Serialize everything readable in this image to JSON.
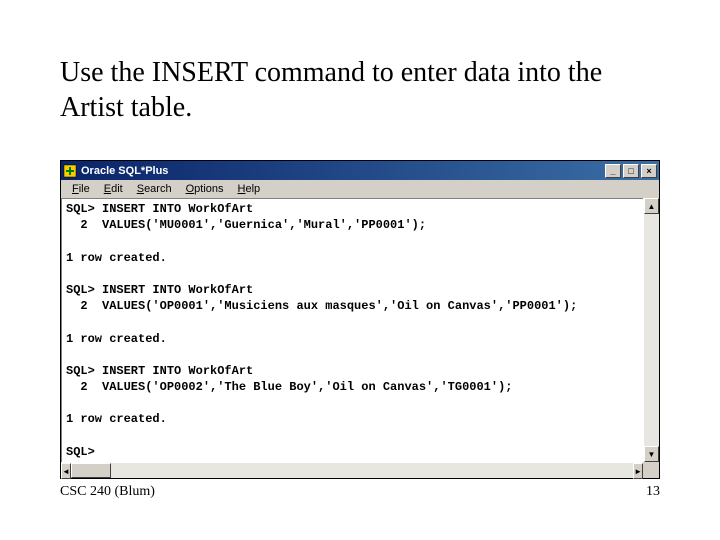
{
  "slide": {
    "title": "Use the INSERT command to enter data into the Artist table."
  },
  "window": {
    "title": "Oracle SQL*Plus"
  },
  "menu": {
    "file": "File",
    "edit": "Edit",
    "search": "Search",
    "options": "Options",
    "help": "Help"
  },
  "terminal": {
    "content": "SQL> INSERT INTO WorkOfArt\n  2  VALUES('MU0001','Guernica','Mural','PP0001');\n\n1 row created.\n\nSQL> INSERT INTO WorkOfArt\n  2  VALUES('OP0001','Musiciens aux masques','Oil on Canvas','PP0001');\n\n1 row created.\n\nSQL> INSERT INTO WorkOfArt\n  2  VALUES('OP0002','The Blue Boy','Oil on Canvas','TG0001');\n\n1 row created.\n\nSQL>"
  },
  "footer": {
    "course": "CSC 240 (Blum)",
    "page": "13"
  },
  "icons": {
    "min": "_",
    "max": "□",
    "close": "×",
    "up": "▲",
    "down": "▼",
    "left": "◄",
    "right": "►"
  }
}
